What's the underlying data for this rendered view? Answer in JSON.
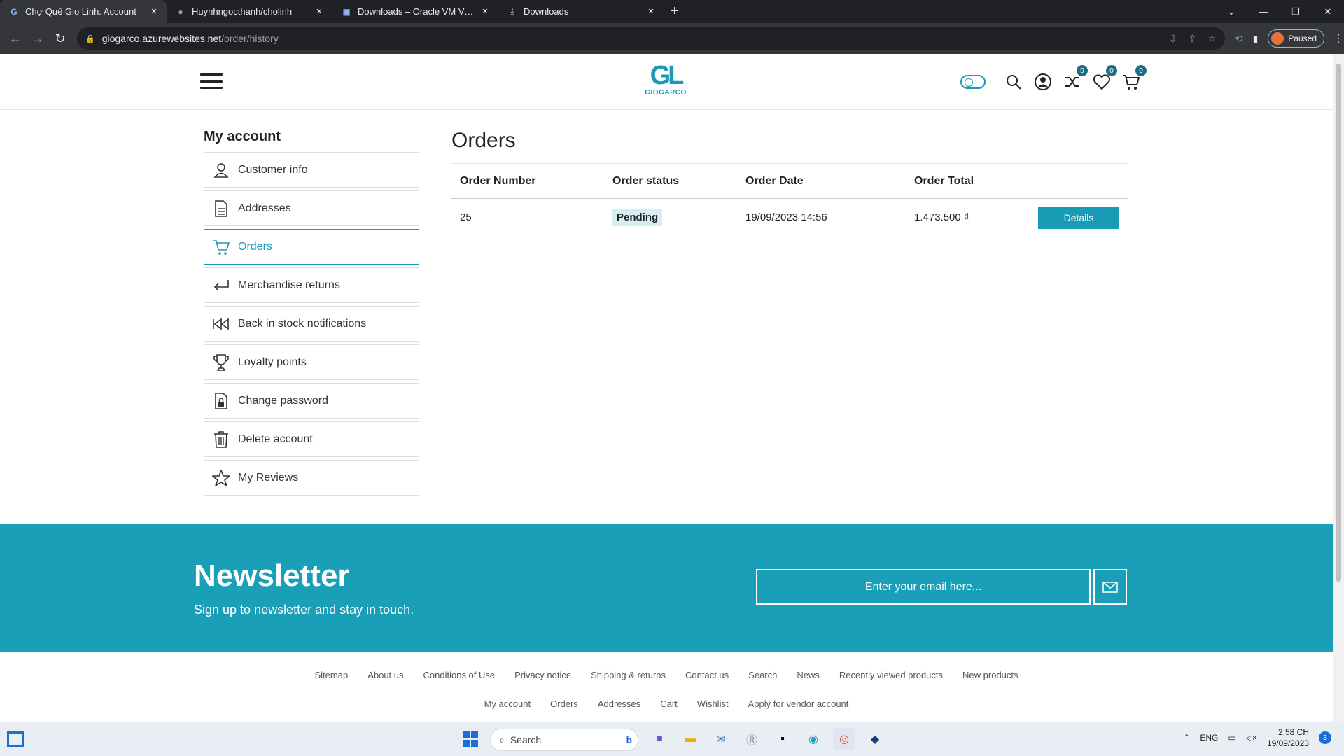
{
  "browser": {
    "tabs": [
      {
        "label": "Chợ Quê Gio Linh. Account",
        "active": true,
        "icon": "gl-favicon"
      },
      {
        "label": "Huynhngocthanh/cholinh",
        "active": false,
        "icon": "github-icon"
      },
      {
        "label": "Downloads – Oracle VM VirtualBox",
        "active": false,
        "icon": "virtualbox-icon"
      },
      {
        "label": "Downloads",
        "active": false,
        "icon": "download-icon"
      }
    ],
    "url_host": "giogarco.azurewebsites.net",
    "url_path": "/order/history",
    "profile_status": "Paused"
  },
  "header": {
    "logo_text": "GIOGARCO",
    "logo_mark": "GL",
    "compare_count": "0",
    "wishlist_count": "0",
    "cart_count": "0"
  },
  "sidebar": {
    "title": "My account",
    "items": [
      {
        "label": "Customer info",
        "icon": "user-icon"
      },
      {
        "label": "Addresses",
        "icon": "address-doc-icon"
      },
      {
        "label": "Orders",
        "icon": "cart-icon",
        "active": true
      },
      {
        "label": "Merchandise returns",
        "icon": "return-arrow-icon"
      },
      {
        "label": "Back in stock notifications",
        "icon": "rewind-icon"
      },
      {
        "label": "Loyalty points",
        "icon": "trophy-icon"
      },
      {
        "label": "Change password",
        "icon": "lock-doc-icon"
      },
      {
        "label": "Delete account",
        "icon": "trash-icon"
      },
      {
        "label": "My Reviews",
        "icon": "star-icon"
      }
    ]
  },
  "orders": {
    "title": "Orders",
    "columns": [
      "Order Number",
      "Order status",
      "Order Date",
      "Order Total"
    ],
    "rows": [
      {
        "number": "25",
        "status": "Pending",
        "date": "19/09/2023 14:56",
        "total": "1.473.500 ₫",
        "action": "Details"
      }
    ]
  },
  "newsletter": {
    "title": "Newsletter",
    "subtitle": "Sign up to newsletter and stay in touch.",
    "placeholder": "Enter your email here..."
  },
  "footer": {
    "row1": [
      "Sitemap",
      "About us",
      "Conditions of Use",
      "Privacy notice",
      "Shipping & returns",
      "Contact us",
      "Search",
      "News",
      "Recently viewed products",
      "New products"
    ],
    "row2": [
      "My account",
      "Orders",
      "Addresses",
      "Cart",
      "Wishlist",
      "Apply for vendor account"
    ]
  },
  "taskbar": {
    "search_placeholder": "Search",
    "language": "ENG",
    "time": "2:58 CH",
    "date": "19/09/2023",
    "notifications": "3"
  },
  "colors": {
    "accent": "#1a9fb8",
    "chrome_dark": "#202124"
  }
}
